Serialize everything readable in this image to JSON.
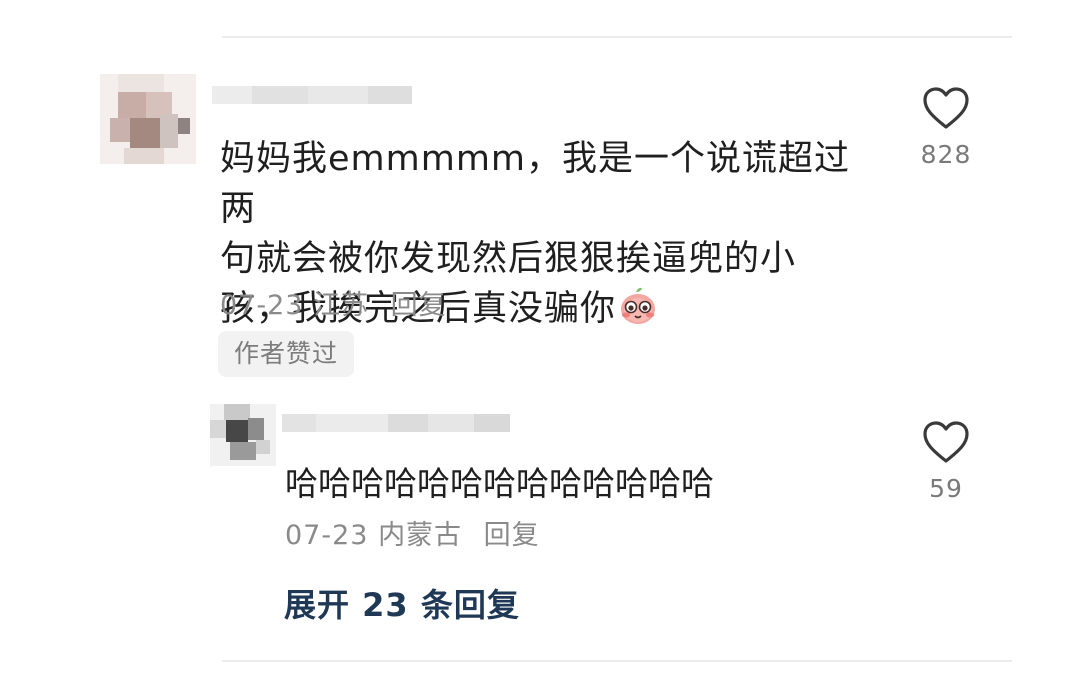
{
  "comment": {
    "text_line1": "妈妈我emmmmm，我是一个说谎超过两",
    "text_line2": "句就会被你发现然后狠狠挨逼兜的小",
    "text_line3": "孩，我挨完之后真没骗你",
    "date": "07-23",
    "location": "江苏",
    "reply_label": "回复",
    "author_liked_badge": "作者赞过",
    "like_count": "828",
    "like_icon": "heart-outline-icon",
    "emoji": "blushing-face-emoji"
  },
  "reply": {
    "text": "哈哈哈哈哈哈哈哈哈哈哈哈哈",
    "date": "07-23",
    "location": "内蒙古",
    "reply_label": "回复",
    "like_count": "59",
    "like_icon": "heart-outline-icon"
  },
  "expand_replies": {
    "label": "展开 23 条回复"
  },
  "colors": {
    "text": "#1f1f1f",
    "meta": "#8a8a8a",
    "link": "#1e3856",
    "badge_bg": "#f2f2f2"
  }
}
